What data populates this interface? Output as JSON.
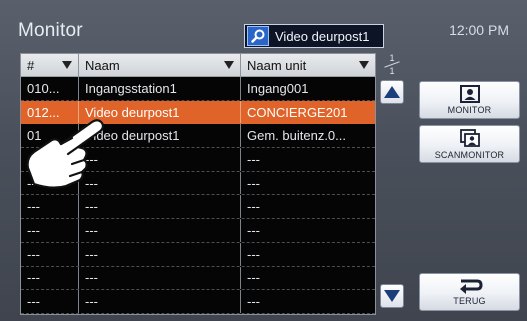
{
  "header": {
    "title": "Monitor",
    "clock": "12:00 PM",
    "search_value": "Video deurpost1"
  },
  "table": {
    "columns": [
      {
        "label": "#"
      },
      {
        "label": "Naam"
      },
      {
        "label": "Naam unit"
      }
    ],
    "rows": [
      {
        "id": "010...",
        "name": "Ingangsstation1",
        "unit": "Ingang001",
        "selected": false
      },
      {
        "id": "012...",
        "name": "Video deurpost1",
        "unit": "CONCIERGE201",
        "selected": true
      },
      {
        "id": "01",
        "name": "Video deurpost1",
        "unit": "Gem. buitenz.0...",
        "selected": false
      },
      {
        "id": "",
        "name": "---",
        "unit": "---",
        "selected": false
      },
      {
        "id": "---",
        "name": "---",
        "unit": "---",
        "selected": false
      },
      {
        "id": "---",
        "name": "---",
        "unit": "---",
        "selected": false
      },
      {
        "id": "---",
        "name": "---",
        "unit": "---",
        "selected": false
      },
      {
        "id": "---",
        "name": "---",
        "unit": "---",
        "selected": false
      },
      {
        "id": "---",
        "name": "---",
        "unit": "---",
        "selected": false
      },
      {
        "id": "---",
        "name": "---",
        "unit": "---",
        "selected": false
      }
    ]
  },
  "pager": {
    "current": "1",
    "total": "1"
  },
  "buttons": {
    "monitor": "MONITOR",
    "scanmonitor": "SCANMONITOR",
    "back": "TERUG"
  },
  "icons": {
    "search": "search-icon",
    "monitor": "person-monitor-icon",
    "scanmonitor": "scan-monitor-icon",
    "back": "return-arrow-icon",
    "scroll_up": "triangle-up-icon",
    "scroll_down": "triangle-down-icon",
    "hand": "pointing-hand-icon"
  },
  "colors": {
    "selected_row": "#e0642a",
    "search_icon_bg": "#2a66c9",
    "table_bg": "#050505"
  }
}
